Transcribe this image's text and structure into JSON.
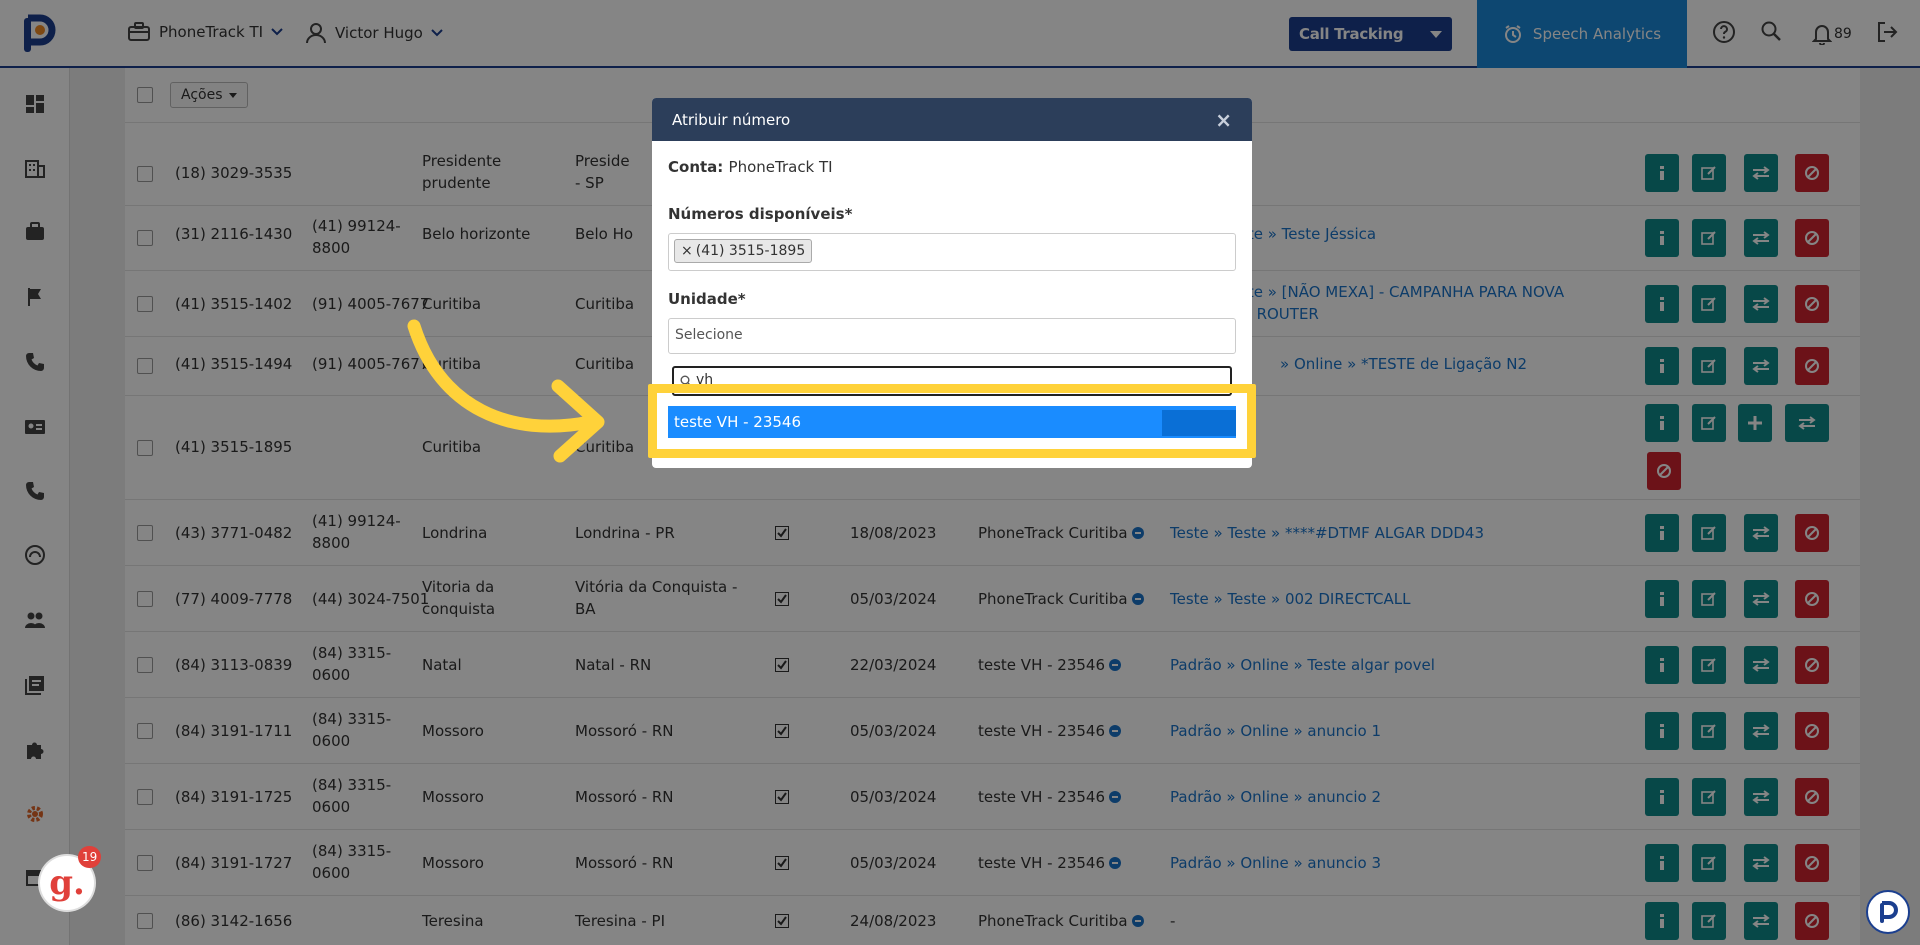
{
  "topbar": {
    "account": "PhoneTrack TI",
    "user": "Victor Hugo",
    "product_select": "Call Tracking",
    "speech": "Speech Analytics",
    "notifications": "89"
  },
  "toolbar": {
    "actions": "Ações"
  },
  "rows": [
    {
      "number": "(18) 3029-3535",
      "redirect": "",
      "city": "Presidente prudente",
      "region": "Preside - SP"
    },
    {
      "number": "(31) 2116-1430",
      "redirect": "(41) 99124-8800",
      "city": "Belo horizonte",
      "region": "Belo Ho",
      "campaign": "ste » Teste Jéssica"
    },
    {
      "number": "(41) 3515-1402",
      "redirect": "(91) 4005-7677",
      "city": "Curitiba",
      "region": "Curitiba",
      "campaign": "ste » [NÃO MEXA] - CAMPANHA PARA NOVA",
      "campaign2": "O ROUTER"
    },
    {
      "number": "(41) 3515-1494",
      "redirect": "(91) 4005-7677",
      "city": "Curitiba",
      "region": "Curitiba",
      "campaign": "» Online » *TESTE de Ligação N2"
    },
    {
      "number": "(41) 3515-1895",
      "redirect": "",
      "city": "Curitiba",
      "region": "Curitiba"
    },
    {
      "number": "(43) 3771-0482",
      "redirect": "(41) 99124-8800",
      "city": "Londrina",
      "region": "Londrina - PR",
      "date": "18/08/2023",
      "unit": "PhoneTrack Curitiba",
      "campaign": "Teste » Teste » ****#DTMF ALGAR DDD43"
    },
    {
      "number": "(77) 4009-7778",
      "redirect": "(44) 3024-7501",
      "city": "Vitoria da conquista",
      "region": "Vitória da Conquista - BA",
      "date": "05/03/2024",
      "unit": "PhoneTrack Curitiba",
      "campaign": "Teste » Teste » 002 DIRECTCALL"
    },
    {
      "number": "(84) 3113-0839",
      "redirect": "(84) 3315-0600",
      "city": "Natal",
      "region": "Natal - RN",
      "date": "22/03/2024",
      "unit": "teste VH - 23546",
      "campaign": "Padrão » Online » Teste algar povel"
    },
    {
      "number": "(84) 3191-1711",
      "redirect": "(84) 3315-0600",
      "city": "Mossoro",
      "region": "Mossoró - RN",
      "date": "05/03/2024",
      "unit": "teste VH - 23546",
      "campaign": "Padrão » Online » anuncio 1"
    },
    {
      "number": "(84) 3191-1725",
      "redirect": "(84) 3315-0600",
      "city": "Mossoro",
      "region": "Mossoró - RN",
      "date": "05/03/2024",
      "unit": "teste VH - 23546",
      "campaign": "Padrão » Online » anuncio 2"
    },
    {
      "number": "(84) 3191-1727",
      "redirect": "(84) 3315-0600",
      "city": "Mossoro",
      "region": "Mossoró - RN",
      "date": "05/03/2024",
      "unit": "teste VH - 23546",
      "campaign": "Padrão » Online » anuncio 3"
    },
    {
      "number": "(86) 3142-1656",
      "redirect": "",
      "city": "Teresina",
      "region": "Teresina - PI",
      "date": "24/08/2023",
      "unit": "PhoneTrack Curitiba",
      "campaign": "-"
    }
  ],
  "modal": {
    "title": "Atribuir número",
    "close": "×",
    "account_label": "Conta:",
    "account_value": "PhoneTrack TI",
    "numbers_label": "Números disponíveis*",
    "selected_number": "(41) 3515-1895",
    "tag_remove": "×",
    "unit_label": "Unidade*",
    "unit_placeholder": "Selecione",
    "search_value": "vh",
    "option": "teste VH - 23546"
  },
  "badge": {
    "count": "19",
    "letter": "g."
  },
  "colors": {
    "brand": "#1b3f8f",
    "accent": "#1a88d8",
    "teal": "#0f8a8a",
    "red": "#d0242f",
    "highlight": "#ffd23a"
  }
}
